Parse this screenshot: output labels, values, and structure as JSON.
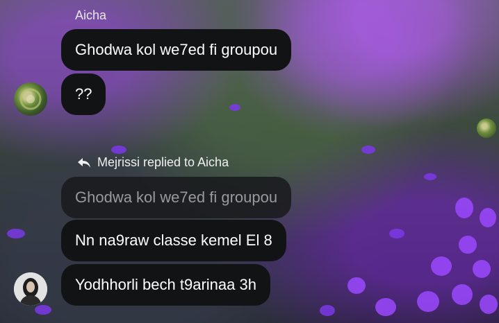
{
  "messages": {
    "sender_name": "Aicha",
    "msg1": "Ghodwa kol we7ed fi groupou",
    "msg2": "??",
    "reply_label": "Mejrissi replied to Aicha",
    "quoted_text": "Ghodwa kol we7ed fi groupou",
    "msg3": "Nn na9raw classe kemel El 8",
    "msg4": "Yodhhorli bech t9arinaa 3h"
  },
  "icons": {
    "reply": "reply-arrow-icon"
  },
  "colors": {
    "bubble": "#121314",
    "accent_purple": "#9b49ff"
  }
}
